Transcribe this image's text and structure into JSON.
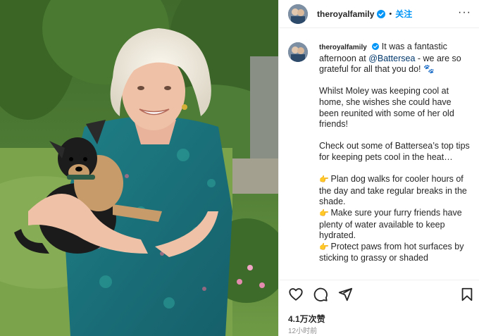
{
  "post": {
    "username": "theroyalfamily",
    "follow_label": "关注",
    "separator": "•",
    "more_label": "···",
    "likes": "4.1万次赞",
    "time_ago": "12小时前"
  },
  "caption": {
    "username": "theroyalfamily",
    "intro_pre": "It was a fantastic afternoon at ",
    "mention": "@Battersea",
    "intro_post": " - we are so grateful for all that you do! 🐾",
    "para2": "Whilst Moley was keeping cool at home, she wishes she could have been reunited with some of her old friends!",
    "para3": "Check out some of Battersea’s top tips for keeping pets cool in the heat…",
    "tip_emoji": "👉",
    "tips": [
      "Plan dog walks for cooler hours of the day and take regular breaks in the shade.",
      "Make sure your furry friends have plenty of water available to keep hydrated.",
      "Protect paws from hot surfaces by sticking to grassy or shaded"
    ]
  },
  "icons": {
    "verified": "verified-badge-icon",
    "like": "heart-icon",
    "comment": "comment-icon",
    "share": "paper-plane-icon",
    "save": "bookmark-icon",
    "more": "more-dots-icon"
  },
  "colors": {
    "accent": "#0095f6",
    "mention": "#00376b",
    "verified": "#0095f6",
    "muted": "#8e8e8e"
  }
}
